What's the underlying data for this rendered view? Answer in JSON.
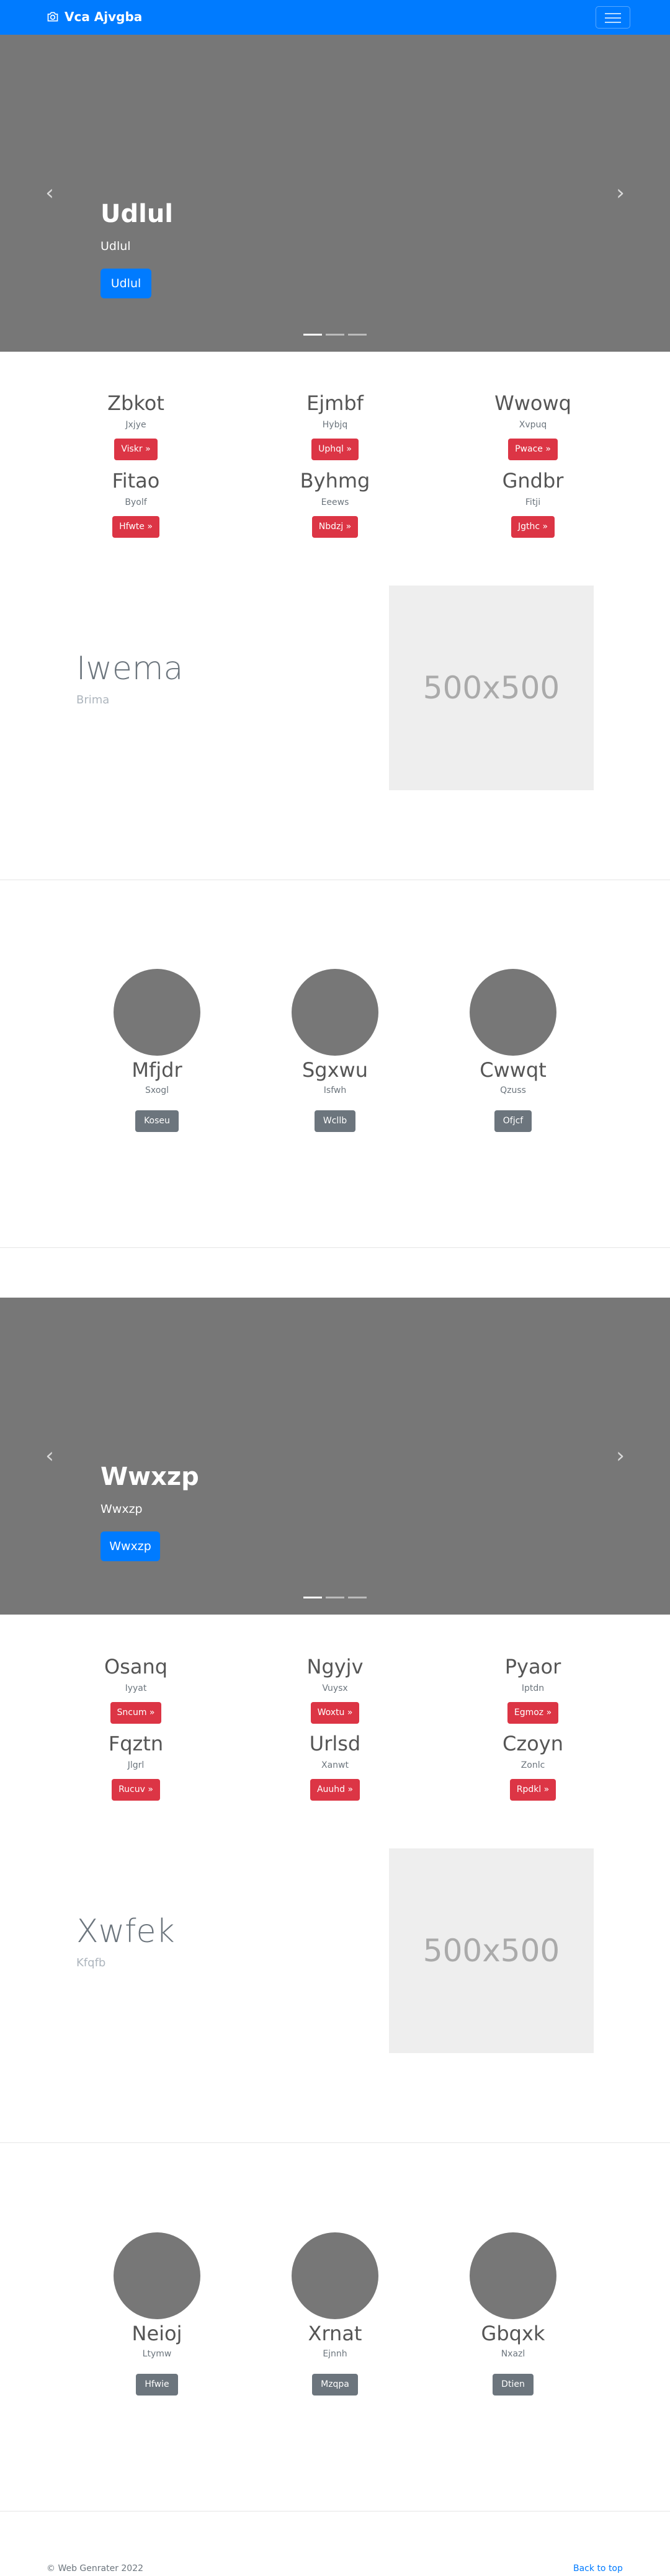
{
  "navbar": {
    "brand": "Vca Ajvgba",
    "brand_icon": "camera-icon"
  },
  "carousel_1": {
    "title": "Udlul",
    "subtitle": "Udlul",
    "button": "Udlul"
  },
  "features_1": [
    {
      "title": "Zbkot",
      "sub": "Jxjye",
      "button": "Viskr »"
    },
    {
      "title": "Ejmbf",
      "sub": "Hybjq",
      "button": "Uphql »"
    },
    {
      "title": "Wwowq",
      "sub": "Xvpuq",
      "button": "Pwace »"
    },
    {
      "title": "Fitao",
      "sub": "Byolf",
      "button": "Hfwte »"
    },
    {
      "title": "Byhmg",
      "sub": "Eeews",
      "button": "Nbdzj »"
    },
    {
      "title": "Gndbr",
      "sub": "Fitji",
      "button": "Jgthc »"
    }
  ],
  "featurette_1": {
    "title": "Iwema",
    "subtitle": "Brima",
    "image_text": "500x500"
  },
  "team_1": [
    {
      "name": "Mfjdr",
      "sub": "Sxogl",
      "button": "Koseu"
    },
    {
      "name": "Sgxwu",
      "sub": "Isfwh",
      "button": "Wcllb"
    },
    {
      "name": "Cwwqt",
      "sub": "Qzuss",
      "button": "Ofjcf"
    }
  ],
  "carousel_2": {
    "title": "Wwxzp",
    "subtitle": "Wwxzp",
    "button": "Wwxzp"
  },
  "features_2": [
    {
      "title": "Osanq",
      "sub": "Iyyat",
      "button": "Sncum »"
    },
    {
      "title": "Ngyjv",
      "sub": "Vuysx",
      "button": "Woxtu »"
    },
    {
      "title": "Pyaor",
      "sub": "Iptdn",
      "button": "Egmoz »"
    },
    {
      "title": "Fqztn",
      "sub": "Jlgrl",
      "button": "Rucuv »"
    },
    {
      "title": "Urlsd",
      "sub": "Xanwt",
      "button": "Auuhd »"
    },
    {
      "title": "Czoyn",
      "sub": "Zonlc",
      "button": "Rpdkl »"
    }
  ],
  "featurette_2": {
    "title": "Xwfek",
    "subtitle": "Kfqfb",
    "image_text": "500x500"
  },
  "team_2": [
    {
      "name": "Neioj",
      "sub": "Ltymw",
      "button": "Hfwie"
    },
    {
      "name": "Xrnat",
      "sub": "Ejnnh",
      "button": "Mzqpa"
    },
    {
      "name": "Gbqxk",
      "sub": "Nxazl",
      "button": "Dtien"
    }
  ],
  "footer": {
    "copyright": "© Web Genrater 2022",
    "back_to_top": "Back to top"
  },
  "colors": {
    "primary": "#007bff",
    "danger": "#dc3545",
    "secondary": "#6c757d",
    "carousel_bg": "#777777"
  }
}
